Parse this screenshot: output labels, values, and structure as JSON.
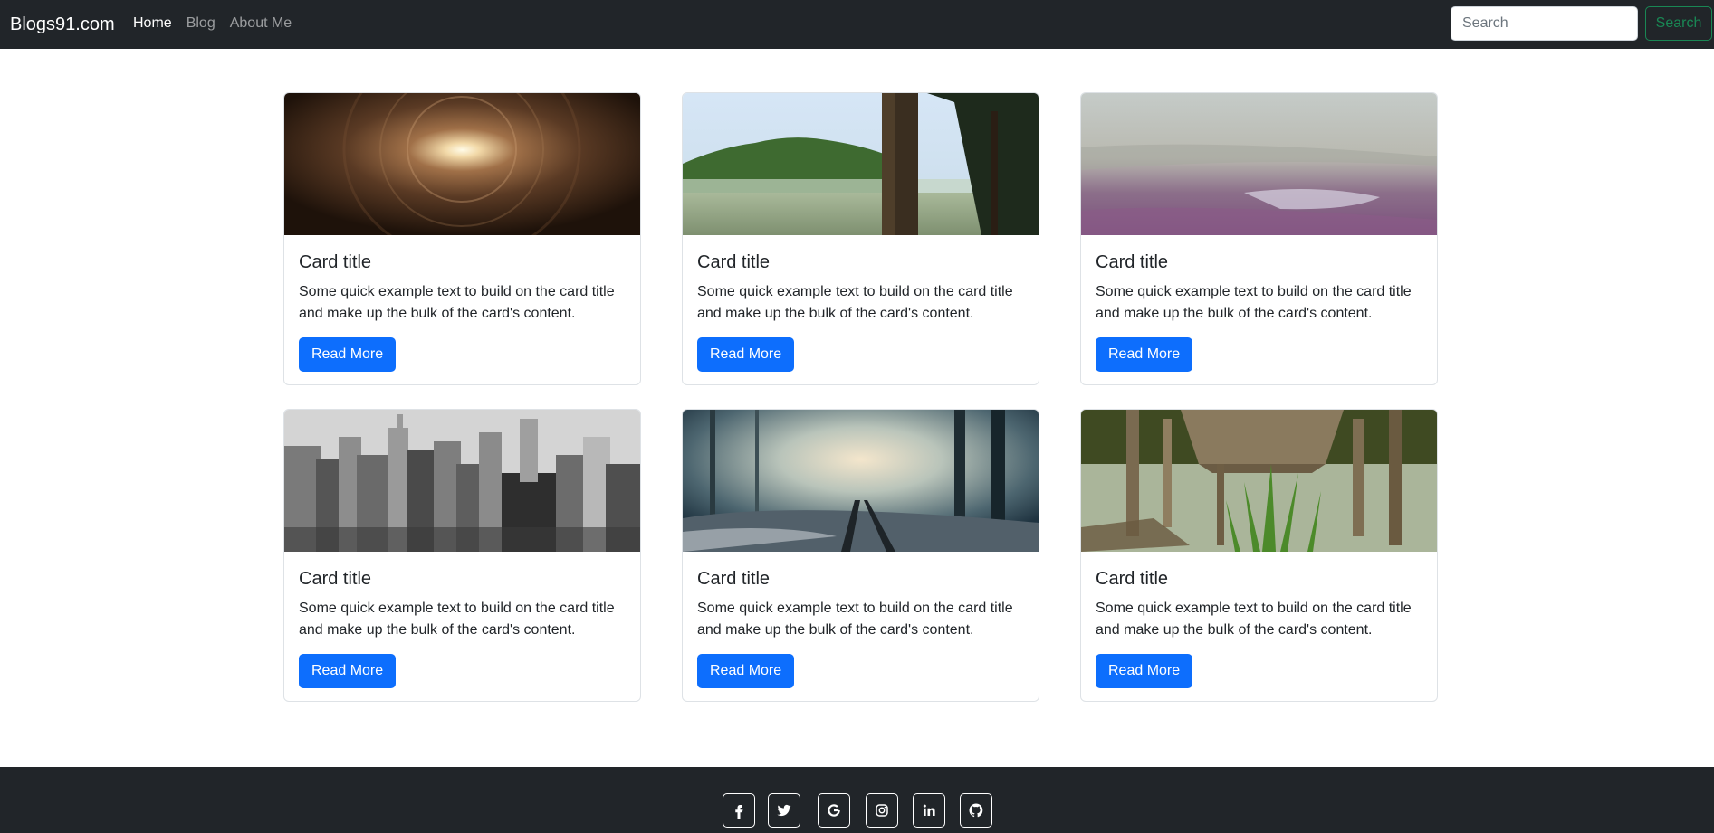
{
  "nav": {
    "brand": "Blogs91.com",
    "links": [
      {
        "label": "Home"
      },
      {
        "label": "Blog"
      },
      {
        "label": "About Me"
      }
    ],
    "search_placeholder": "Search",
    "search_button": "Search"
  },
  "cards": [
    {
      "title": "Card title",
      "text": "Some quick example text to build on the card title and make up the bulk of the card's content.",
      "button": "Read More",
      "image": "tunnel-light-image"
    },
    {
      "title": "Card title",
      "text": "Some quick example text to build on the card title and make up the bulk of the card's content.",
      "button": "Read More",
      "image": "misty-lake-pier-image"
    },
    {
      "title": "Card title",
      "text": "Some quick example text to build on the card title and make up the bulk of the card's content.",
      "button": "Read More",
      "image": "hazy-beach-image"
    },
    {
      "title": "Card title",
      "text": "Some quick example text to build on the card title and make up the bulk of the card's content.",
      "button": "Read More",
      "image": "city-skyline-image"
    },
    {
      "title": "Card title",
      "text": "Some quick example text to build on the card title and make up the bulk of the card's content.",
      "button": "Read More",
      "image": "foggy-forest-railway-image"
    },
    {
      "title": "Card title",
      "text": "Some quick example text to build on the card title and make up the bulk of the card's content.",
      "button": "Read More",
      "image": "wooden-dock-grass-image"
    }
  ],
  "footer": {
    "social_icons": [
      "facebook-icon",
      "twitter-icon",
      "google-icon",
      "instagram-icon",
      "linkedin-icon",
      "github-icon"
    ]
  },
  "colors": {
    "navbar_bg": "#212529",
    "primary": "#0d6efd",
    "success": "#198754",
    "border": "#dee2e6"
  }
}
